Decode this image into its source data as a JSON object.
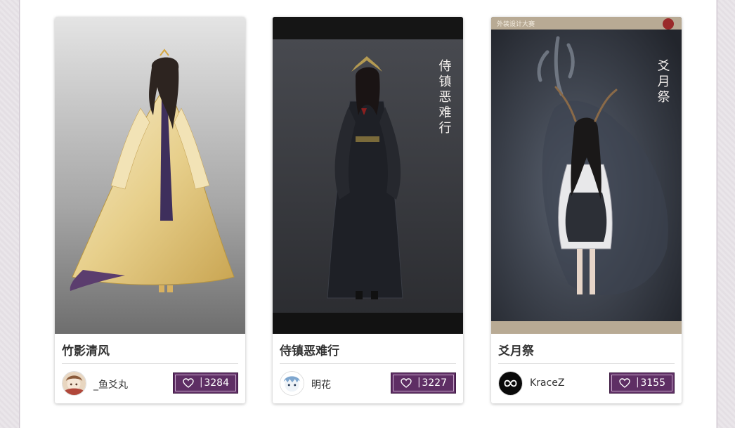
{
  "colors": {
    "accent": "#5e2e64",
    "panel_background": "#ffffff",
    "page_background": "#ece8ec"
  },
  "cards": [
    {
      "title": "竹影清风",
      "author": "_鱼爻丸",
      "likes": "3284",
      "image": "character-in-yellow-gown",
      "avatar": "avatar-illustration",
      "like_icon": "heart-icon",
      "separator": "|"
    },
    {
      "title": "侍镇恶难行",
      "author": "明花",
      "likes": "3227",
      "image": "character-in-black-armor",
      "image_caption": "侍镇恶难行",
      "avatar": "avatar-illustration",
      "like_icon": "heart-icon",
      "separator": "|"
    },
    {
      "title": "爻月祭",
      "author": "KraceZ",
      "likes": "3155",
      "image": "character-with-deer-antlers",
      "image_caption": "爻月祭",
      "image_banner": "外装设计大赛",
      "avatar": "avatar-logo",
      "like_icon": "heart-icon",
      "separator": "|"
    }
  ]
}
